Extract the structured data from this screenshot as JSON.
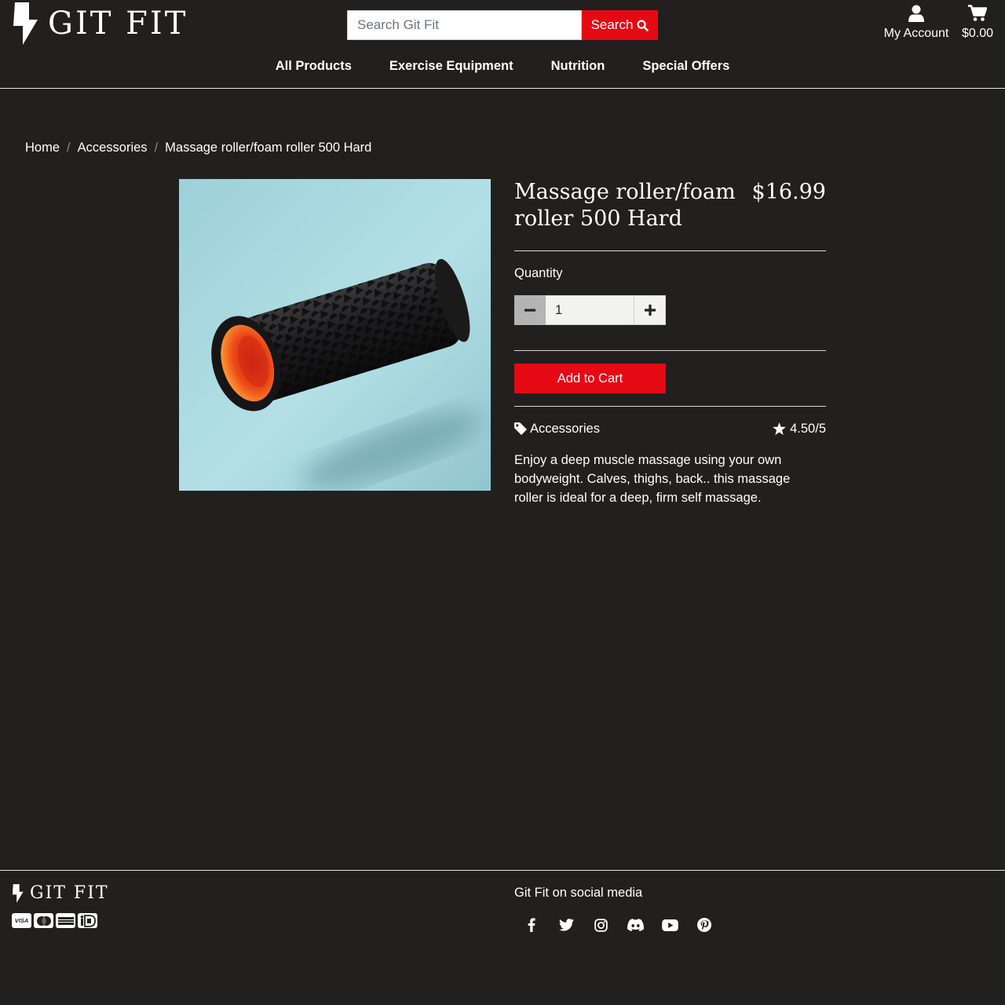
{
  "site": {
    "name": "GIT FIT"
  },
  "header": {
    "search_placeholder": "Search Git Fit",
    "search_button": "Search",
    "account_label": "My Account",
    "cart_total": "$0.00"
  },
  "nav": [
    {
      "label": "All Products"
    },
    {
      "label": "Exercise Equipment"
    },
    {
      "label": "Nutrition"
    },
    {
      "label": "Special Offers"
    }
  ],
  "breadcrumb": {
    "home": "Home",
    "category": "Accessories",
    "current": "Massage roller/foam roller 500 Hard"
  },
  "product": {
    "title": "Massage roller/foam roller 500 Hard",
    "price": "$16.99",
    "quantity_label": "Quantity",
    "quantity_value": "1",
    "add_to_cart": "Add to Cart",
    "category": "Accessories",
    "rating": "4.50/5",
    "description": "Enjoy a deep muscle massage using your own bodyweight. Calves, thighs, back.. this massage roller is ideal for a deep, firm self massage."
  },
  "footer": {
    "social_title": "Git Fit on social media",
    "payment_icons": [
      "visa-icon",
      "mastercard-icon",
      "amex-icon",
      "ideal-icon"
    ],
    "social_icons": [
      "facebook-icon",
      "twitter-icon",
      "instagram-icon",
      "discord-icon",
      "youtube-icon",
      "pinterest-icon"
    ]
  },
  "colors": {
    "background": "#21201f",
    "accent": "#e50914",
    "text": "#ffffff",
    "product_bg": "#a9d8e0",
    "roller_orange": "#f06a1a"
  }
}
